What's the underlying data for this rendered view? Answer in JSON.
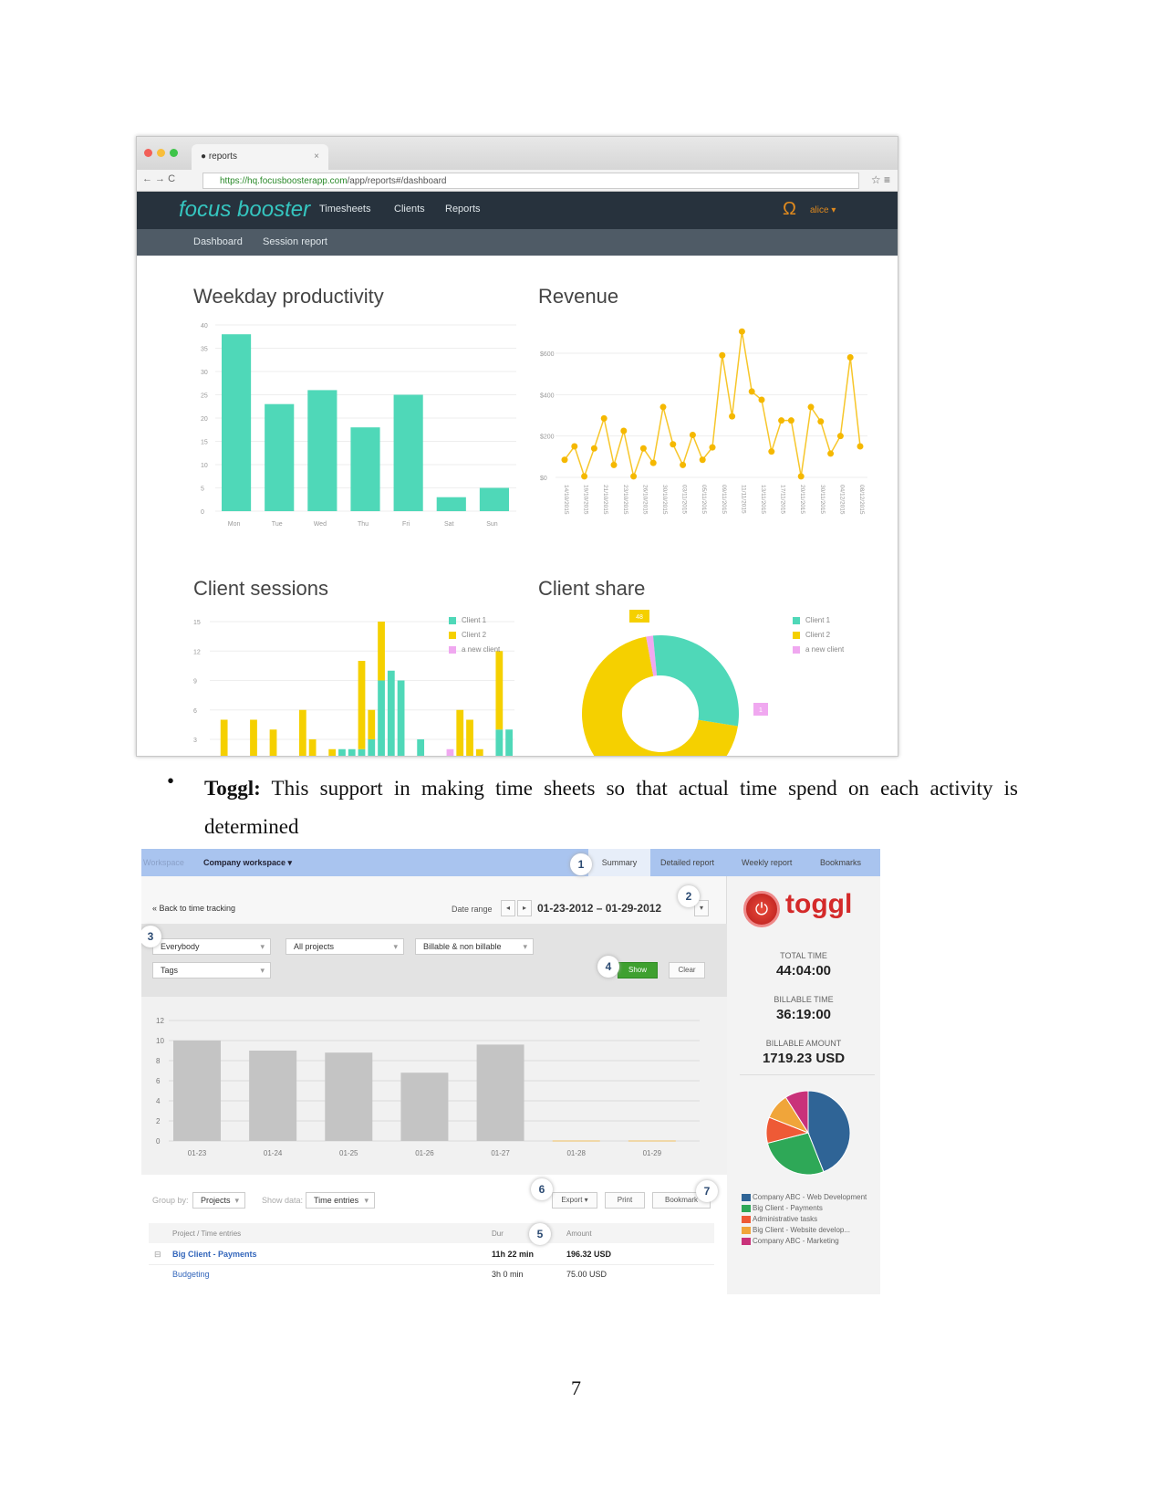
{
  "focusbooster": {
    "tab_title": "reports",
    "url_host": "https://hq.focusboosterapp.com",
    "url_path": "/app/reports#/dashboard",
    "logo": "focus booster",
    "nav": [
      "Timesheets",
      "Clients",
      "Reports"
    ],
    "user": "alice ▾",
    "subnav": [
      "Dashboard",
      "Session report"
    ],
    "colors": {
      "teal": "#4fd8b8",
      "yellow": "#f5d000",
      "pink": "#f0a8f0",
      "navbar": "#27323d"
    }
  },
  "chart_data": [
    {
      "type": "bar",
      "title": "Weekday productivity",
      "categories": [
        "Mon",
        "Tue",
        "Wed",
        "Thu",
        "Fri",
        "Sat",
        "Sun"
      ],
      "values": [
        38,
        23,
        26,
        18,
        25,
        3,
        5
      ],
      "yticks": [
        0,
        5,
        10,
        15,
        20,
        25,
        30,
        35,
        40
      ],
      "ylim": [
        0,
        40
      ],
      "grid": true
    },
    {
      "type": "line",
      "title": "Revenue",
      "yticks": [
        "$0",
        "$200",
        "$400",
        "$600"
      ],
      "ylim": [
        0,
        700
      ],
      "grid": true,
      "x_labels": [
        "14/10/2015",
        "19/10/2015",
        "21/10/2015",
        "23/10/2015",
        "26/10/2015",
        "30/10/2015",
        "03/11/2015",
        "05/11/2015",
        "09/11/2015",
        "11/11/2015",
        "13/11/2015",
        "17/11/2015",
        "20/11/2015",
        "30/11/2015",
        "04/12/2015",
        "08/12/2015"
      ],
      "values": [
        85,
        150,
        5,
        140,
        285,
        60,
        225,
        5,
        140,
        70,
        340,
        160,
        60,
        205,
        85,
        145,
        590,
        295,
        705,
        415,
        375,
        125,
        275,
        275,
        5,
        340,
        270,
        115,
        200,
        580,
        150
      ]
    },
    {
      "type": "bar",
      "title": "Client sessions",
      "stacked": true,
      "yticks": [
        3,
        6,
        9,
        12,
        15
      ],
      "legend": "top-right",
      "series": [
        {
          "name": "Client 1",
          "values": [
            1,
            1,
            1,
            0,
            0,
            0,
            0,
            0,
            0,
            0,
            0,
            0,
            0,
            2,
            2,
            2,
            3,
            9,
            10,
            9,
            0,
            3,
            0,
            0,
            0,
            0,
            0,
            0,
            0,
            4,
            4
          ]
        },
        {
          "name": "Client 2",
          "values": [
            0,
            4,
            0,
            0,
            5,
            0,
            4,
            0,
            0,
            6,
            3,
            0,
            2,
            0,
            0,
            9,
            3,
            6,
            0,
            0,
            0,
            0,
            0,
            0,
            0,
            6,
            5,
            2,
            0,
            8,
            0
          ]
        },
        {
          "name": "a new client",
          "values": [
            0,
            0,
            0,
            0,
            0,
            0,
            0,
            0,
            0,
            0,
            0,
            0,
            0,
            0,
            0,
            0,
            0,
            0,
            0,
            0,
            0,
            0,
            0,
            0,
            2,
            0,
            0,
            0,
            0,
            0,
            0
          ]
        }
      ]
    },
    {
      "type": "pie",
      "title": "Client share",
      "donut": true,
      "legend": "top-right",
      "series": [
        {
          "name": "Client 1",
          "value": 20
        },
        {
          "name": "Client 2",
          "value": 48
        },
        {
          "name": "a new client",
          "value": 1
        }
      ],
      "data_labels": [
        "48",
        "1"
      ]
    },
    {
      "type": "bar",
      "yticks": [
        0,
        2,
        4,
        6,
        8,
        10,
        12
      ],
      "ylim": [
        0,
        12
      ],
      "categories": [
        "01-23",
        "01-24",
        "01-25",
        "01-26",
        "01-27",
        "01-28",
        "01-29"
      ],
      "values": [
        10,
        9,
        8.8,
        6.8,
        9.6,
        0,
        0
      ],
      "grid": true
    },
    {
      "type": "pie",
      "series": [
        {
          "name": "Company ABC - Web Development",
          "value": 44,
          "color": "#2f6496"
        },
        {
          "name": "Big Client - Payments",
          "value": 27,
          "color": "#2ea857"
        },
        {
          "name": "Administrative tasks",
          "value": 10,
          "color": "#ee5a36"
        },
        {
          "name": "Big Client - Website develop...",
          "value": 10,
          "color": "#f0a53a"
        },
        {
          "name": "Company ABC - Marketing",
          "value": 9,
          "color": "#c9327a"
        }
      ]
    }
  ],
  "body": {
    "bullet": "•",
    "bold": "Toggl:",
    "text": " This support in making time sheets so that actual time spend on each activity is determined"
  },
  "toggl": {
    "workspace_label": "Workspace",
    "workspace": "Company workspace ▾",
    "tabs": [
      "Summary",
      "Detailed report",
      "Weekly report",
      "Bookmarks"
    ],
    "back": "« Back to time tracking",
    "date_label": "Date range",
    "date_value": "01-23-2012 – 01-29-2012",
    "filters": [
      "Everybody",
      "All projects",
      "Billable & non billable",
      "Tags"
    ],
    "show": "Show",
    "clear": "Clear",
    "logo": "toggl",
    "stats": [
      {
        "label": "TOTAL TIME",
        "value": "44:04:00"
      },
      {
        "label": "BILLABLE TIME",
        "value": "36:19:00"
      },
      {
        "label": "BILLABLE AMOUNT",
        "value": "1719.23 USD"
      }
    ],
    "group_by_label": "Group by:",
    "group_by": "Projects",
    "show_data_label": "Show data:",
    "show_data": "Time entries",
    "export": "Export ▾",
    "print": "Print",
    "bookmark": "Bookmark",
    "table_headers": [
      "Project / Time entries",
      "Dur",
      "Amount"
    ],
    "rows": [
      {
        "name": "Big Client - Payments",
        "dur": "11h 22 min",
        "amount": "196.32 USD"
      },
      {
        "name": "Budgeting",
        "dur": "3h 0 min",
        "amount": "75.00 USD"
      }
    ],
    "callouts": [
      "1",
      "2",
      "3",
      "4",
      "5",
      "6",
      "7"
    ]
  },
  "page_number": "7"
}
